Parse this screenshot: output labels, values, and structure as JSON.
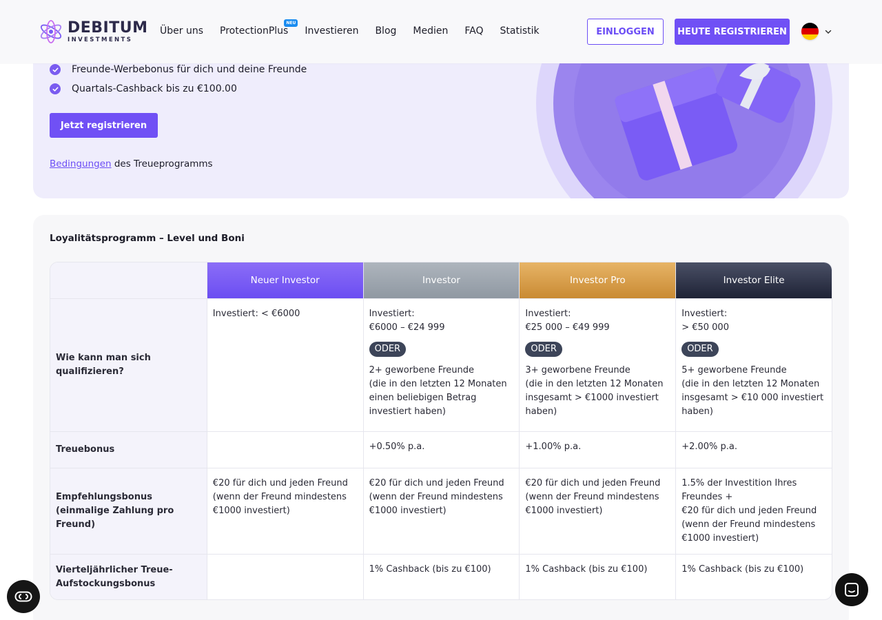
{
  "brand": {
    "name": "DEBITUM",
    "sub": "INVESTMENTS"
  },
  "nav": {
    "items": [
      "Über uns",
      "ProtectionPlus",
      "Investieren",
      "Blog",
      "Medien",
      "FAQ",
      "Statistik"
    ],
    "badge": "NEU"
  },
  "header": {
    "login": "EINLOGGEN",
    "register": "HEUTE REGISTRIEREN",
    "language": "de-flag-icon"
  },
  "promo": {
    "bullets": [
      "Freunde-Werbebonus für dich und deine Freunde",
      "Quartals-Cashback bis zu €100.00"
    ],
    "cta": "Jetzt registrieren",
    "terms_link": "Bedingungen",
    "terms_rest": " des Treueprogramms"
  },
  "table": {
    "title": "Loyalitätsprogramm – Level und Boni",
    "levels": [
      "Neuer Investor",
      "Investor",
      "Investor Pro",
      "Investor Elite"
    ],
    "colors": {
      "new": "#7a5cf5",
      "investor": "#9ea6af",
      "pro": "#d89e4a",
      "elite": "#2a2f44"
    },
    "rows": {
      "qualify": {
        "label": "Wie kann man sich qualifizieren?",
        "new": "Investiert: < €6000",
        "investor_a": [
          "Investiert:",
          "€6000 – €24 999"
        ],
        "pro_a": [
          "Investiert:",
          "€25 000 – €49 999"
        ],
        "elite_a": [
          "Investiert:",
          "> €50 000"
        ],
        "oder": "ODER",
        "investor_b": [
          "2+ geworbene Freunde",
          "(die in den letzten 12 Monaten",
          "einen beliebigen Betrag",
          "investiert haben)"
        ],
        "pro_b": [
          "3+ geworbene Freunde",
          "(die in den letzten 12 Monaten",
          "insgesamt > €1000 investiert",
          "haben)"
        ],
        "elite_b": [
          "5+ geworbene Freunde",
          "(die in den letzten 12 Monaten",
          "insgesamt > €10 000 investiert",
          "haben)"
        ]
      },
      "loyalty": {
        "label": "Treuebonus",
        "new": "",
        "investor": "+0.50% p.a.",
        "pro": "+1.00% p.a.",
        "elite": "+2.00% p.a."
      },
      "referral": {
        "label": "Empfehlungsbonus (einmalige Zahlung pro Freund)",
        "new": [
          "€20 für dich und jeden Freund",
          "(wenn der Freund mindestens",
          "€1000 investiert)"
        ],
        "investor": [
          "€20 für dich und jeden Freund",
          "(wenn der Freund mindestens",
          "€1000 investiert)"
        ],
        "pro": [
          "€20 für dich und jeden Freund",
          "(wenn der Freund mindestens",
          "€1000 investiert)"
        ],
        "elite": [
          "1.5% der Investition Ihres",
          "Freundes +",
          "€20 für dich und jeden Freund",
          "(wenn der Freund mindestens",
          "€1000 investiert)"
        ]
      },
      "cashback": {
        "label": "Vierteljährlicher Treue-Aufstockungsbonus",
        "new": "",
        "investor": "1% Cashback (bis zu €100)",
        "pro": "1% Cashback (bis zu €100)",
        "elite": "1% Cashback (bis zu €100)"
      }
    }
  },
  "widgets": {
    "left": "accessibility-icon",
    "right": "chat-icon"
  }
}
